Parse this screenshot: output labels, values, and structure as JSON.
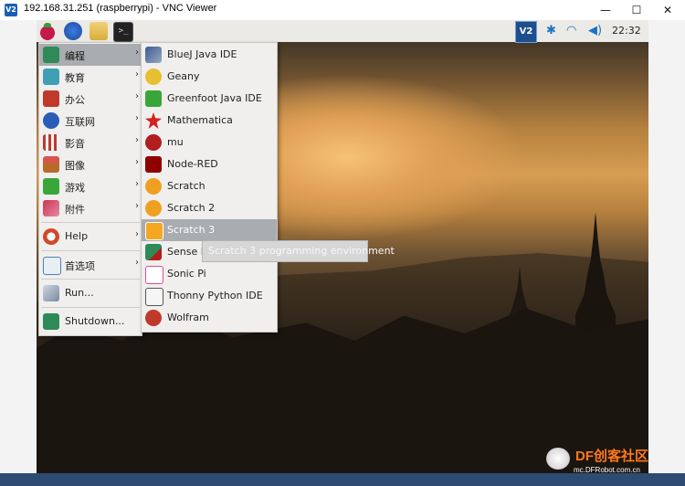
{
  "window": {
    "logo": "V2",
    "title": "192.168.31.251 (raspberrypi) - VNC Viewer",
    "min_icon": "minimize-icon",
    "max_icon": "maximize-icon",
    "close_icon": "close-icon",
    "min_glyph": "—",
    "max_glyph": "☐",
    "close_glyph": "✕"
  },
  "taskbar": {
    "clock": "22:32",
    "vnc_tray": "V2"
  },
  "main_menu": {
    "items": [
      {
        "label": "编程",
        "icon": "programming-icon",
        "color": "#2e8b57"
      },
      {
        "label": "教育",
        "icon": "education-icon",
        "color": "#3fa0b5"
      },
      {
        "label": "办公",
        "icon": "office-icon",
        "color": "#c0392b"
      },
      {
        "label": "互联网",
        "icon": "internet-icon",
        "color": "#2a5db8"
      },
      {
        "label": "影音",
        "icon": "sound-video-icon",
        "color": "#c0392b"
      },
      {
        "label": "图像",
        "icon": "graphics-icon",
        "color": "#b86a2a"
      },
      {
        "label": "游戏",
        "icon": "games-icon",
        "color": "#3aa63a"
      },
      {
        "label": "附件",
        "icon": "accessories-icon",
        "color": "#cc3355"
      },
      {
        "label": "Help",
        "icon": "help-icon",
        "color": "#d04a2a"
      },
      {
        "label": "首选项",
        "icon": "preferences-icon",
        "color": "#4a7fb5"
      },
      {
        "label": "Run...",
        "icon": "run-icon",
        "color": "#7a8aa0"
      },
      {
        "label": "Shutdown...",
        "icon": "shutdown-icon",
        "color": "#2e8b57"
      }
    ],
    "arrow": "›"
  },
  "submenu": {
    "items": [
      {
        "label": "BlueJ Java IDE",
        "icon": "bluej-icon",
        "color": "#3b5998"
      },
      {
        "label": "Geany",
        "icon": "geany-icon",
        "color": "#e6c030"
      },
      {
        "label": "Greenfoot Java IDE",
        "icon": "greenfoot-icon",
        "color": "#3aa63a"
      },
      {
        "label": "Mathematica",
        "icon": "mathematica-icon",
        "color": "#d0231f"
      },
      {
        "label": "mu",
        "icon": "mu-icon",
        "color": "#b01e1e"
      },
      {
        "label": "Node-RED",
        "icon": "node-red-icon",
        "color": "#8f0000"
      },
      {
        "label": "Scratch",
        "icon": "scratch-icon",
        "color": "#f0a020"
      },
      {
        "label": "Scratch 2",
        "icon": "scratch2-icon",
        "color": "#f0a020"
      },
      {
        "label": "Scratch 3",
        "icon": "scratch3-icon",
        "color": "#f5a623"
      },
      {
        "label": "Sense H",
        "icon": "sense-hat-icon",
        "color": "#2e8b57"
      },
      {
        "label": "Sonic Pi",
        "icon": "sonic-pi-icon",
        "color": "#e04a9a"
      },
      {
        "label": "Thonny Python IDE",
        "icon": "thonny-icon",
        "color": "#555555"
      },
      {
        "label": "Wolfram",
        "icon": "wolfram-icon",
        "color": "#c0392b"
      }
    ]
  },
  "tooltip": "Scratch 3 programming environment",
  "host_taskbar_text": "...",
  "watermark": {
    "title": "DF创客社区",
    "url": "mc.DFRobot.com.cn"
  }
}
